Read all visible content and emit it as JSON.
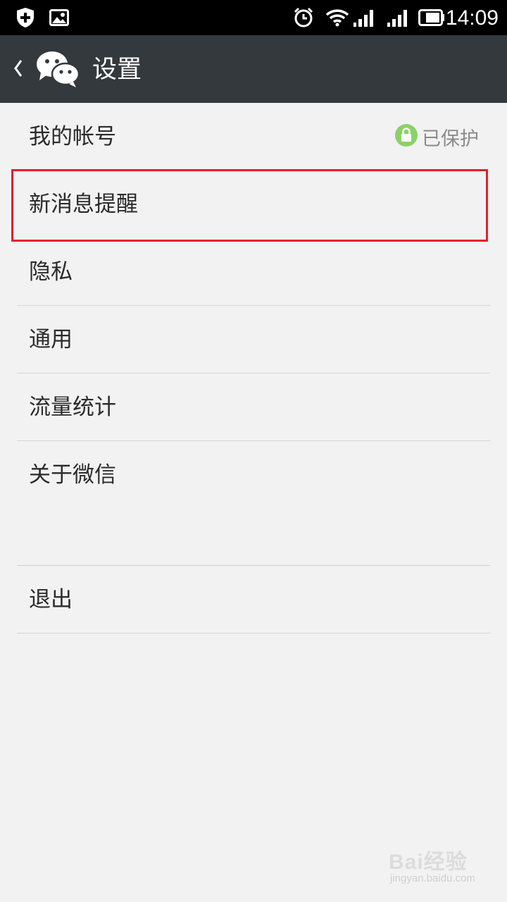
{
  "status_bar": {
    "time": "14:09",
    "icons": [
      "shield-plus-icon",
      "image-icon",
      "alarm-icon",
      "wifi-icon",
      "signal-icon",
      "signal-icon",
      "battery-icon"
    ]
  },
  "header": {
    "title": "设置",
    "background": "#34393d"
  },
  "settings": {
    "account": {
      "label": "我的帐号",
      "status": "已保护"
    },
    "items": [
      {
        "label": "新消息提醒"
      },
      {
        "label": "隐私"
      },
      {
        "label": "通用"
      },
      {
        "label": "流量统计"
      },
      {
        "label": "关于微信"
      }
    ],
    "logout": {
      "label": "退出"
    }
  },
  "highlight_color": "#e3202e",
  "watermark": {
    "main": "Bai经验",
    "sub": "jingyan.baidu.com"
  }
}
